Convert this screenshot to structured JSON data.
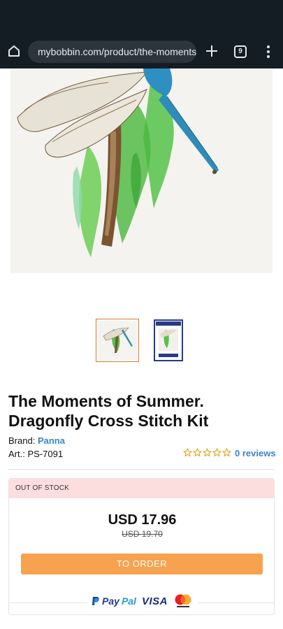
{
  "browser": {
    "url": "mybobbin.com/product/the-moments-of-summer-dragonfly",
    "tab_count": "9",
    "icons": [
      "home-icon",
      "site-settings-icon",
      "plus-icon",
      "tabs-icon",
      "menu-icon"
    ]
  },
  "product": {
    "title": "The Moments of Summer. Dragonfly Cross Stitch Kit",
    "brand_label": "Brand:",
    "brand_value": "Panna",
    "art_label": "Art.:",
    "art_value": "PS-7091",
    "rating_stars": 0,
    "reviews": "0 reviews"
  },
  "order": {
    "status": "OUT OF STOCK",
    "price": "USD 17.96",
    "old_price": "USD 19.70",
    "button_label": "TO ORDER",
    "payment": {
      "paypal_a": "Pay",
      "paypal_b": "Pal",
      "visa": "VISA",
      "mastercard": "mastercard"
    }
  },
  "colors": {
    "toolbar_bg": "#141d24",
    "link_blue": "#3a86c8",
    "order_button": "#f7a24f",
    "out_of_stock_bg": "#fddede",
    "star_outline": "#e2a21b"
  }
}
